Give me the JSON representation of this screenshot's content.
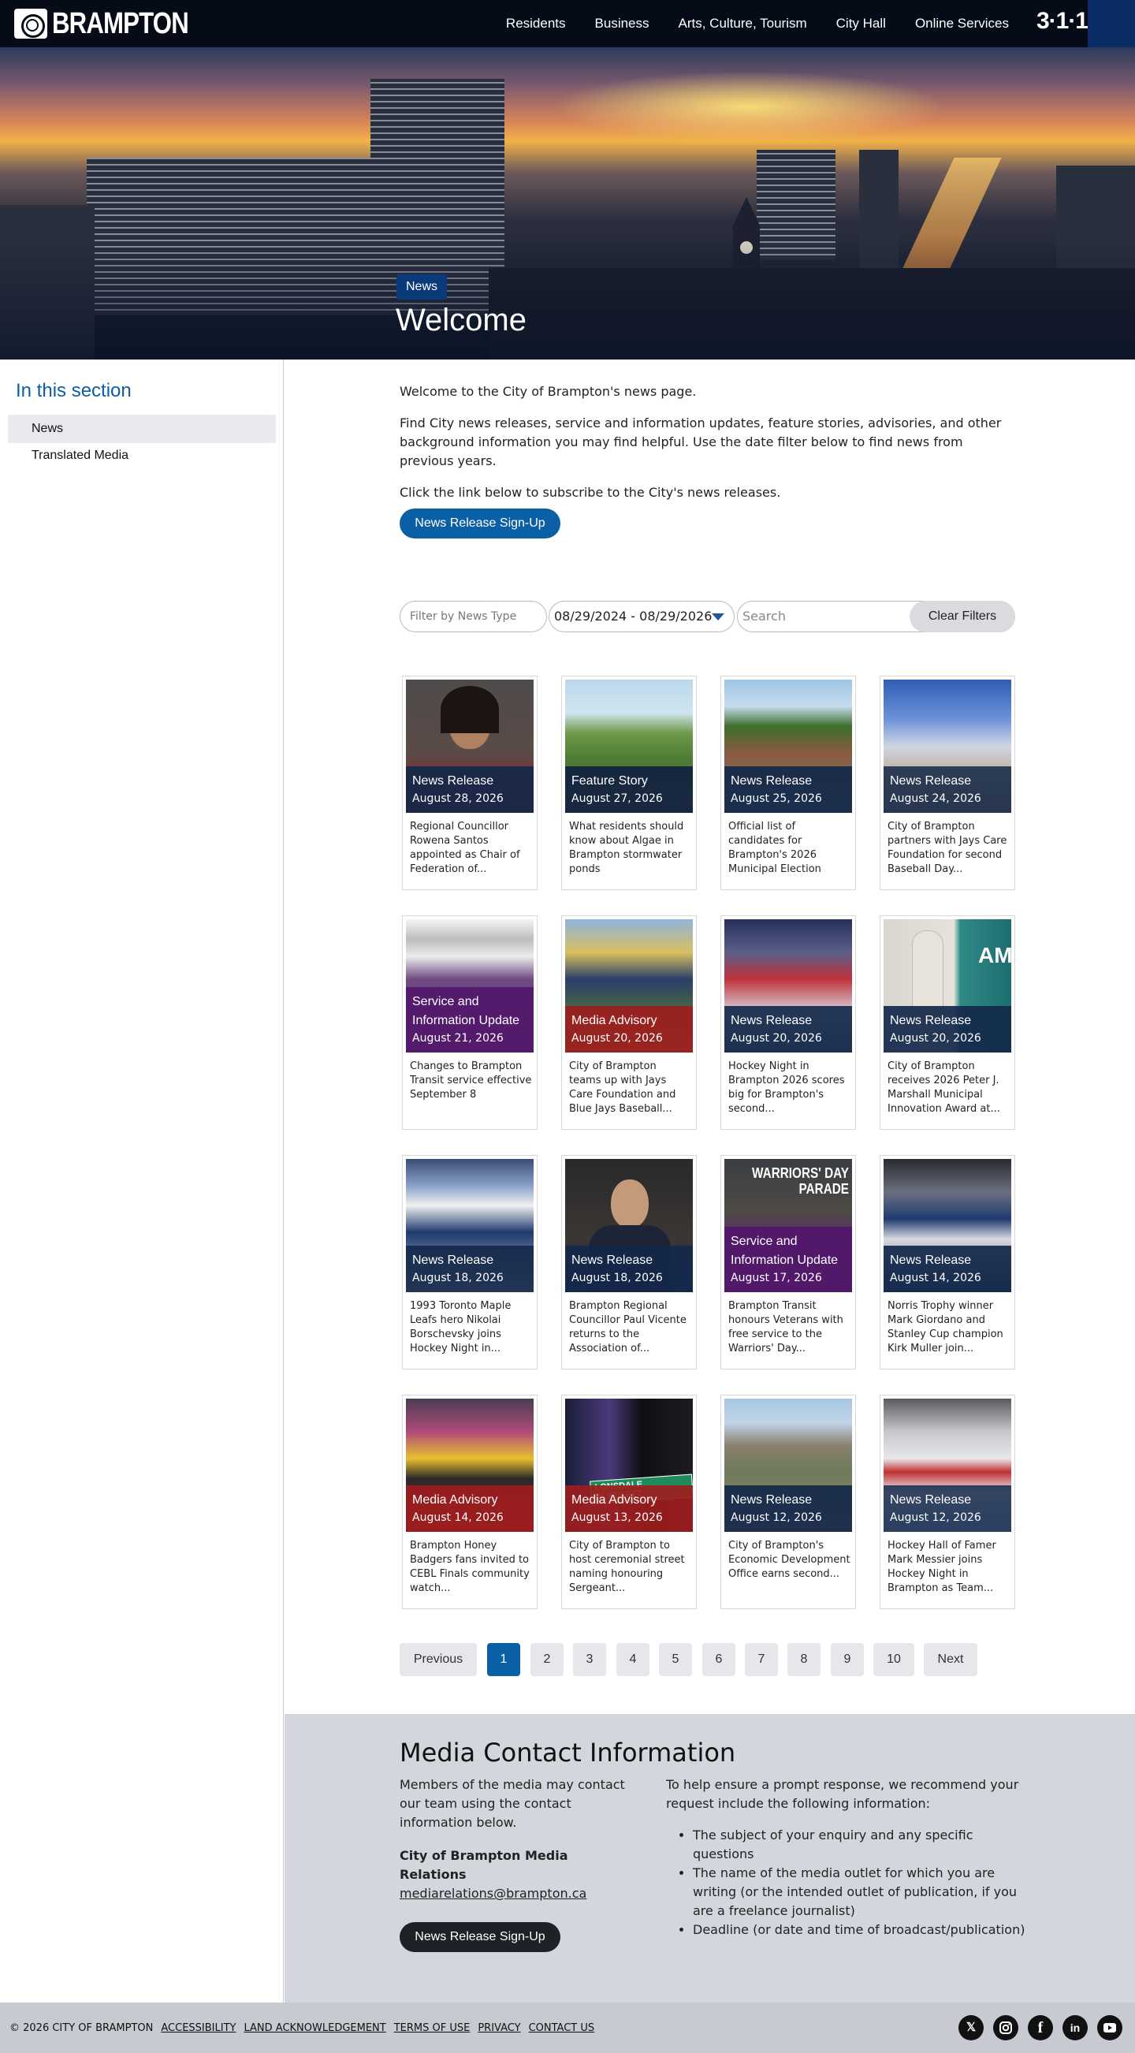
{
  "header": {
    "logo_text": "BRAMPTON",
    "nav": [
      "Residents",
      "Business",
      "Arts, Culture, Tourism",
      "City Hall",
      "Online Services"
    ],
    "tag_311": "3·1·1"
  },
  "hero": {
    "badge": "News",
    "title": "Welcome"
  },
  "sidebar": {
    "title": "In this section",
    "items": [
      {
        "label": "News",
        "active": true
      },
      {
        "label": "Translated Media",
        "active": false
      }
    ]
  },
  "intro": {
    "p1": "Welcome to the City of Brampton's news page.",
    "p2": "Find City news releases, service and information updates, feature stories, advisories, and other background information you may find helpful. Use the date filter below to find news from previous years.",
    "p3": "Click the link below to subscribe to the City's news releases.",
    "signup_label": "News Release Sign-Up"
  },
  "filters": {
    "type_placeholder": "Filter by News Type",
    "date_range": "08/29/2024 - 08/29/2026",
    "search_placeholder": "Search",
    "clear_label": "Clear Filters"
  },
  "colors": {
    "news_release": "#13284a",
    "feature_story": "#11223f",
    "service_update": "#52186b",
    "media_advisory": "#9c1d1e",
    "accent": "#0b5fa5"
  },
  "cards": [
    {
      "type": "News Release",
      "date": "August 28, 2026",
      "text": "Regional Councillor Rowena Santos appointed as Chair of Federation of..."
    },
    {
      "type": "Feature Story",
      "date": "August 27, 2026",
      "text": "What residents should know about Algae in Brampton stormwater ponds"
    },
    {
      "type": "News Release",
      "date": "August 25, 2026",
      "text": "Official list of candidates for Brampton's 2026 Municipal Election"
    },
    {
      "type": "News Release",
      "date": "August 24, 2026",
      "text": "City of Brampton partners with Jays Care Foundation for second Baseball Day..."
    },
    {
      "type": "Service and Information Update",
      "date": "August 21, 2026",
      "text": "Changes to Brampton Transit service effective September 8"
    },
    {
      "type": "Media Advisory",
      "date": "August 20, 2026",
      "text": "City of Brampton teams up with Jays Care Foundation and Blue Jays Baseball..."
    },
    {
      "type": "News Release",
      "date": "August 20, 2026",
      "text": "Hockey Night in Brampton 2026 scores big for Brampton's second..."
    },
    {
      "type": "News Release",
      "date": "August 20, 2026",
      "text": "City of Brampton receives 2026 Peter J. Marshall Municipal Innovation Award at..."
    },
    {
      "type": "News Release",
      "date": "August 18, 2026",
      "text": "1993 Toronto Maple Leafs hero Nikolai Borschevsky joins Hockey Night in..."
    },
    {
      "type": "News Release",
      "date": "August 18, 2026",
      "text": "Brampton Regional Councillor Paul Vicente returns to the Association of..."
    },
    {
      "type": "Service and Information Update",
      "date": "August 17, 2026",
      "text": "Brampton Transit honours Veterans with free service to the Warriors' Day...",
      "img_text": "WARRIORS' DAY PARADE"
    },
    {
      "type": "News Release",
      "date": "August 14, 2026",
      "text": "Norris Trophy winner Mark Giordano and Stanley Cup champion Kirk Muller join..."
    },
    {
      "type": "Media Advisory",
      "date": "August 14, 2026",
      "text": "Brampton Honey Badgers fans invited to CEBL Finals community watch..."
    },
    {
      "type": "Media Advisory",
      "date": "August 13, 2026",
      "text": "City of Brampton to host ceremonial street naming honouring Sergeant...",
      "img_text": "LONSDALE BLACKETT"
    },
    {
      "type": "News Release",
      "date": "August 12, 2026",
      "text": "City of Brampton's Economic Development Office earns second..."
    },
    {
      "type": "News Release",
      "date": "August 12, 2026",
      "text": "Hockey Hall of Famer Mark Messier joins Hockey Night in Brampton as Team..."
    }
  ],
  "pagination": {
    "prev": "Previous",
    "pages": [
      "1",
      "2",
      "3",
      "4",
      "5",
      "6",
      "7",
      "8",
      "9",
      "10"
    ],
    "current": "1",
    "next": "Next"
  },
  "contact": {
    "title": "Media Contact Information",
    "left_text": "Members of the media may contact our team using the contact information below.",
    "org": "City of Brampton Media Relations",
    "email": "mediarelations@brampton.ca",
    "signup_label": "News Release Sign-Up",
    "right_intro": "To help ensure a prompt response, we recommend your request include the following information:",
    "bullets": [
      "The subject of your enquiry and any specific questions",
      "The name of the media outlet for which you are writing (or the intended outlet of publication, if you are a freelance journalist)",
      "Deadline (or date and time of broadcast/publication)"
    ]
  },
  "footer": {
    "copyright": "© 2026 CITY OF BRAMPTON",
    "links": [
      "ACCESSIBILITY",
      "LAND ACKNOWLEDGEMENT",
      "TERMS OF USE",
      "PRIVACY",
      "CONTACT US"
    ],
    "social": [
      "x-icon",
      "instagram-icon",
      "facebook-icon",
      "linkedin-icon",
      "youtube-icon"
    ]
  }
}
